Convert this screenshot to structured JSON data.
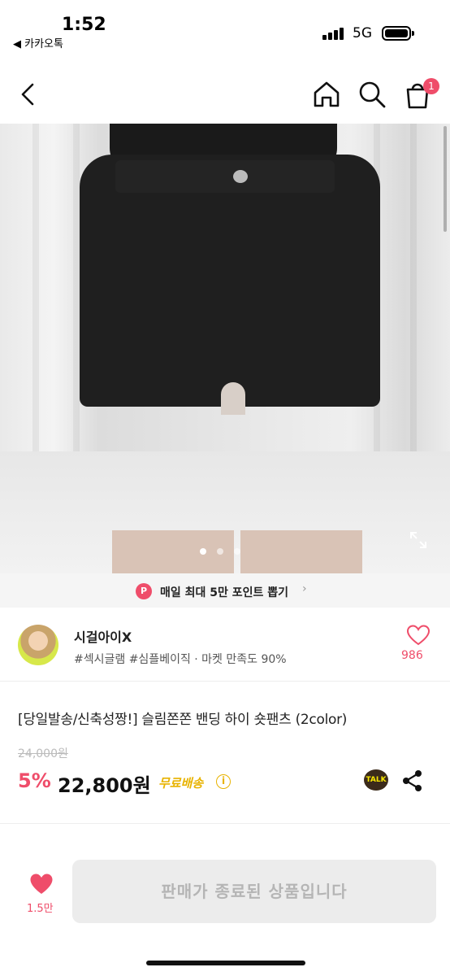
{
  "status_bar": {
    "time": "1:52",
    "back_app": "◀ 카카오톡",
    "network": "5G"
  },
  "nav": {
    "cart_count": "1",
    "icons": [
      "back-arrow-icon",
      "home-icon",
      "search-icon",
      "shopping-bag-icon"
    ]
  },
  "gallery": {
    "slide_count": 3,
    "active_slide": 1
  },
  "points_banner": {
    "icon_letter": "P",
    "text": "매일 최대 5만 포인트 뽑기",
    "chevron": "›"
  },
  "seller": {
    "name": "시걸아이X",
    "tags": "#섹시글램 #심플베이직 · 마켓 만족도 90%",
    "favorite_count": "986"
  },
  "product": {
    "title": "[당일발송/신축성짱!] 슬림쫀쫀 밴딩 하이 숏팬츠 (2color)",
    "original_price": "24,000원",
    "discount": "5%",
    "price": "22,800원",
    "shipping": "무료배송",
    "info_symbol": "i",
    "talk_label": "TALK"
  },
  "bottom_bar": {
    "like_count": "1.5만",
    "cta_label": "판매가 종료된 상품입니다"
  },
  "colors": {
    "accent": "#ef4d6a",
    "shipping": "#e8b300",
    "disabled_bg": "#ececec",
    "disabled_text": "#b5b5b5"
  }
}
